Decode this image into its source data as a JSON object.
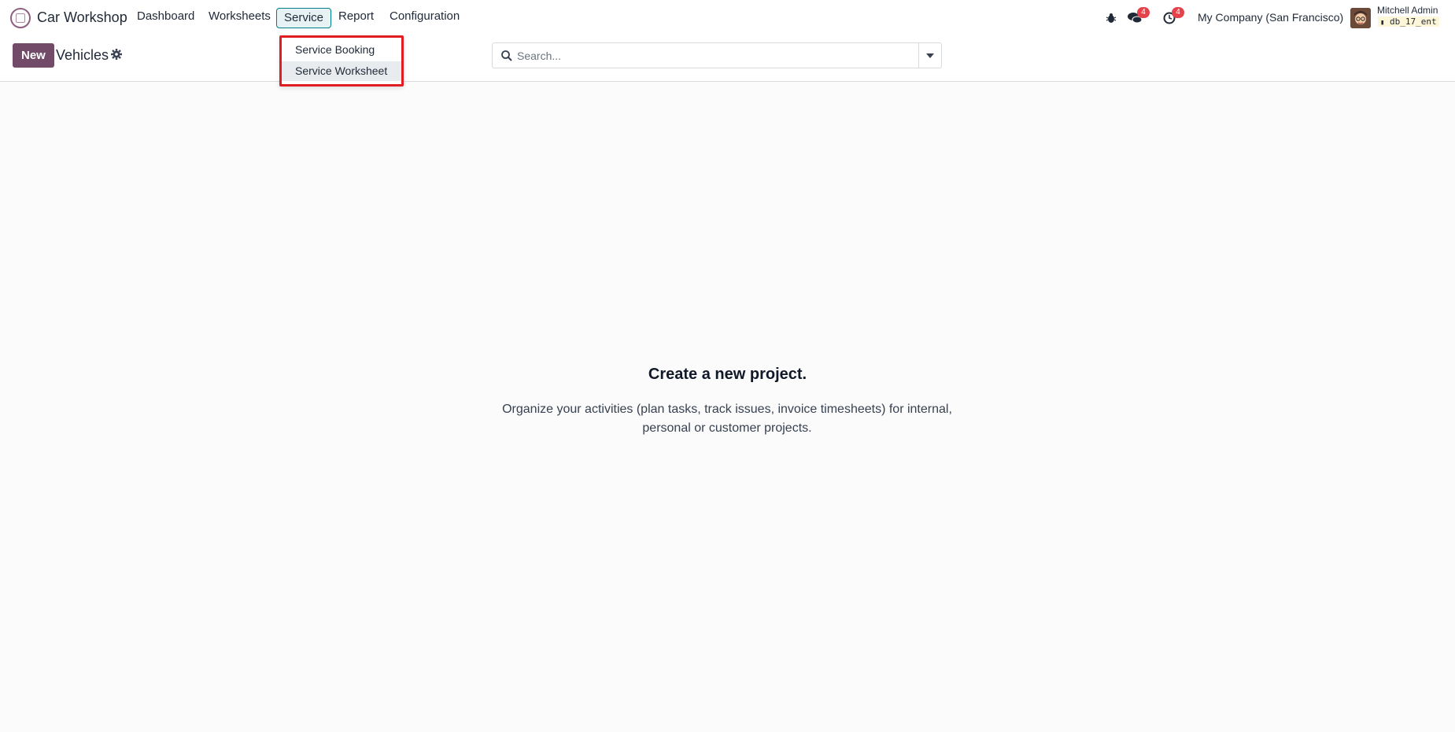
{
  "app": {
    "name": "Car Workshop",
    "logo_icon": "car-workshop-logo-icon"
  },
  "nav": {
    "items": [
      {
        "label": "Dashboard"
      },
      {
        "label": "Worksheets"
      },
      {
        "label": "Service"
      },
      {
        "label": "Report"
      },
      {
        "label": "Configuration"
      }
    ]
  },
  "dropdown": {
    "items": [
      {
        "label": "Service Booking"
      },
      {
        "label": "Service Worksheet"
      }
    ]
  },
  "systray": {
    "debug_icon": "bug-icon",
    "messages_icon": "chat-icon",
    "messages_count": "4",
    "activities_icon": "clock-icon",
    "activities_count": "4",
    "company": "My Company (San Francisco)",
    "user_name": "Mitchell Admin",
    "db_name": "db_17_ent"
  },
  "control_panel": {
    "new_label": "New",
    "title": "Vehicles",
    "gear_icon": "gear-icon"
  },
  "search": {
    "placeholder": "Search..."
  },
  "helper": {
    "title": "Create a new project.",
    "text": "Organize your activities (plan tasks, track issues, invoice timesheets) for internal, personal or customer projects."
  },
  "colors": {
    "brand": "#714b67",
    "active_nav_border": "#017e84",
    "highlight_box": "#e11d24",
    "badge": "#e5424a"
  }
}
